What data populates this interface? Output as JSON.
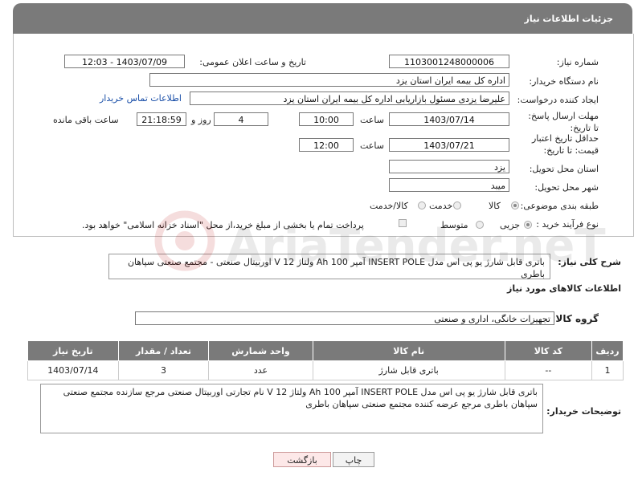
{
  "header": {
    "title": "جزئیات اطلاعات نیاز"
  },
  "form": {
    "need_number_label": "شماره نیاز:",
    "need_number": "1103001248000006",
    "announce_label": "تاریخ و ساعت اعلان عمومی:",
    "announce_value": "1403/07/09 - 12:03",
    "buyer_org_label": "نام دستگاه خریدار:",
    "buyer_org": "اداره کل بیمه ایران استان یزد",
    "requester_label": "ایجاد کننده درخواست:",
    "requester": "علیرضا یزدی مسئول بازاریابی اداره کل بیمه ایران استان یزد",
    "contact_link": "اطلاعات تماس خریدار",
    "deadline_label": "مهلت ارسال پاسخ: تا تاریخ:",
    "deadline_date": "1403/07/14",
    "time_label": "ساعت",
    "deadline_time": "10:00",
    "days_value": "4",
    "days_label": "روز و",
    "remaining_time": "21:18:59",
    "remaining_label": "ساعت باقی مانده",
    "validity_label": "حداقل تاریخ اعتبار قیمت: تا تاریخ:",
    "validity_date": "1403/07/21",
    "validity_time": "12:00",
    "province_label": "استان محل تحویل:",
    "province": "یزد",
    "city_label": "شهر محل تحویل:",
    "city": "میبد",
    "category_label": "طبقه بندی موضوعی:",
    "category_options": [
      "کالا",
      "خدمت",
      "کالا/خدمت"
    ],
    "category_selected": "کالا",
    "process_label": "نوع فرآیند خرید :",
    "process_options": [
      "جزیی",
      "متوسط"
    ],
    "process_selected": "جزیی",
    "payment_note": "پرداخت تمام یا بخشی از مبلغ خرید،از محل \"اسناد خزانه اسلامی\" خواهد بود."
  },
  "summary": {
    "label": "شرح کلی نیاز:",
    "text": "باتری قابل شارژ یو پی اس مدل INSERT POLE آمپر 100 Ah ولتاژ 12 V اوربیتال صنعتی - مجتمع صنعتی سپاهان باطری"
  },
  "goods": {
    "section_title": "اطلاعات کالاهای مورد نیاز",
    "group_label": "گروه کالا:",
    "group_value": "تجهیزات خانگی، اداری و صنعتی",
    "columns": [
      "ردیف",
      "کد کالا",
      "نام کالا",
      "واحد شمارش",
      "تعداد / مقدار",
      "تاریخ نیاز"
    ],
    "rows": [
      {
        "row": "1",
        "code": "--",
        "name": "باتری قابل شارژ",
        "unit": "عدد",
        "qty": "3",
        "date": "1403/07/14"
      }
    ]
  },
  "buyer_desc": {
    "label": "توضیحات خریدار:",
    "text": "باتری قابل شارژ یو پی اس مدل INSERT POLE آمپر 100 Ah ولتاژ 12 V نام تجارتی اوربیتال صنعتی مرجع سازنده مجتمع صنعتی سپاهان باطری مرجع عرضه کننده مجتمع صنعتی سپاهان باطری"
  },
  "buttons": {
    "print": "چاپ",
    "back": "بازگشت"
  },
  "watermark": {
    "text": "AriaTender.neT"
  }
}
